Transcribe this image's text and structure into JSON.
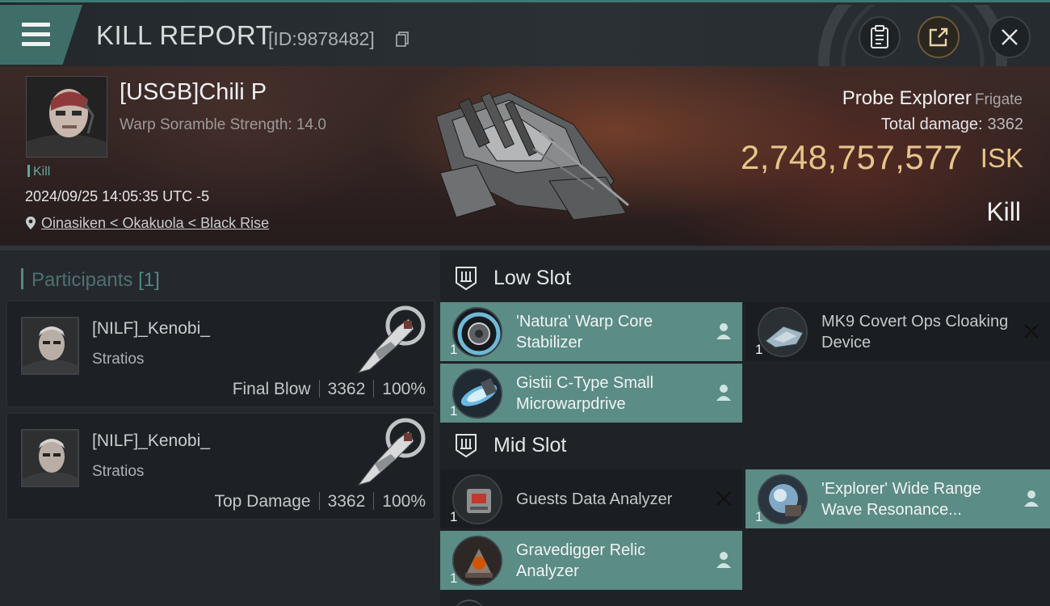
{
  "header": {
    "title": "KILL REPORT",
    "report_id": "[ID:9878482]"
  },
  "victim": {
    "name": "[USGB]Chili P",
    "warp_scramble": "Warp Soramble Strength: 14.0",
    "kill_tag": "Kill",
    "datetime": "2024/09/25 14:05:35 UTC -5",
    "location": "Oinasiken < Okakuola < Black Rise",
    "ship_name": "Probe Explorer",
    "ship_class": "Frigate",
    "total_damage_label": "Total damage:",
    "total_damage": "3362",
    "isk_value": "2,748,757,577",
    "isk_unit": "ISK",
    "result": "Kill"
  },
  "participants": {
    "label": "Participants",
    "count": "[1]",
    "items": [
      {
        "name": "[NILF]_Kenobi_",
        "ship": "Stratios",
        "role": "Final Blow",
        "damage": "3362",
        "percent": "100%"
      },
      {
        "name": "[NILF]_Kenobi_",
        "ship": "Stratios",
        "role": "Top Damage",
        "damage": "3362",
        "percent": "100%"
      }
    ]
  },
  "fitting": {
    "low_slot": {
      "title": "Low Slot",
      "modules": [
        {
          "name": "'Natura' Warp Core Stabilizer",
          "qty": "1",
          "state": "dropped"
        },
        {
          "name": "MK9 Covert Ops Cloaking Device",
          "qty": "1",
          "state": "destroyed"
        },
        {
          "name": "Gistii C-Type Small Microwarpdrive",
          "qty": "1",
          "state": "dropped"
        }
      ]
    },
    "mid_slot": {
      "title": "Mid Slot",
      "modules": [
        {
          "name": "Guests Data Analyzer",
          "qty": "1",
          "state": "destroyed"
        },
        {
          "name": "'Explorer' Wide Range Wave Resonance...",
          "qty": "1",
          "state": "dropped"
        },
        {
          "name": "Gravedigger Relic Analyzer",
          "qty": "1",
          "state": "dropped"
        }
      ]
    }
  },
  "colors": {
    "accent_teal": "#5b8c85",
    "isk_gold": "#e7c48a",
    "menu_teal": "#3f6e69"
  },
  "icons": [
    "menu-icon",
    "copy-icon",
    "clipboard-icon",
    "share-icon",
    "close-icon",
    "location-pin-icon",
    "slot-icon",
    "person-icon",
    "destroyed-x-icon"
  ]
}
